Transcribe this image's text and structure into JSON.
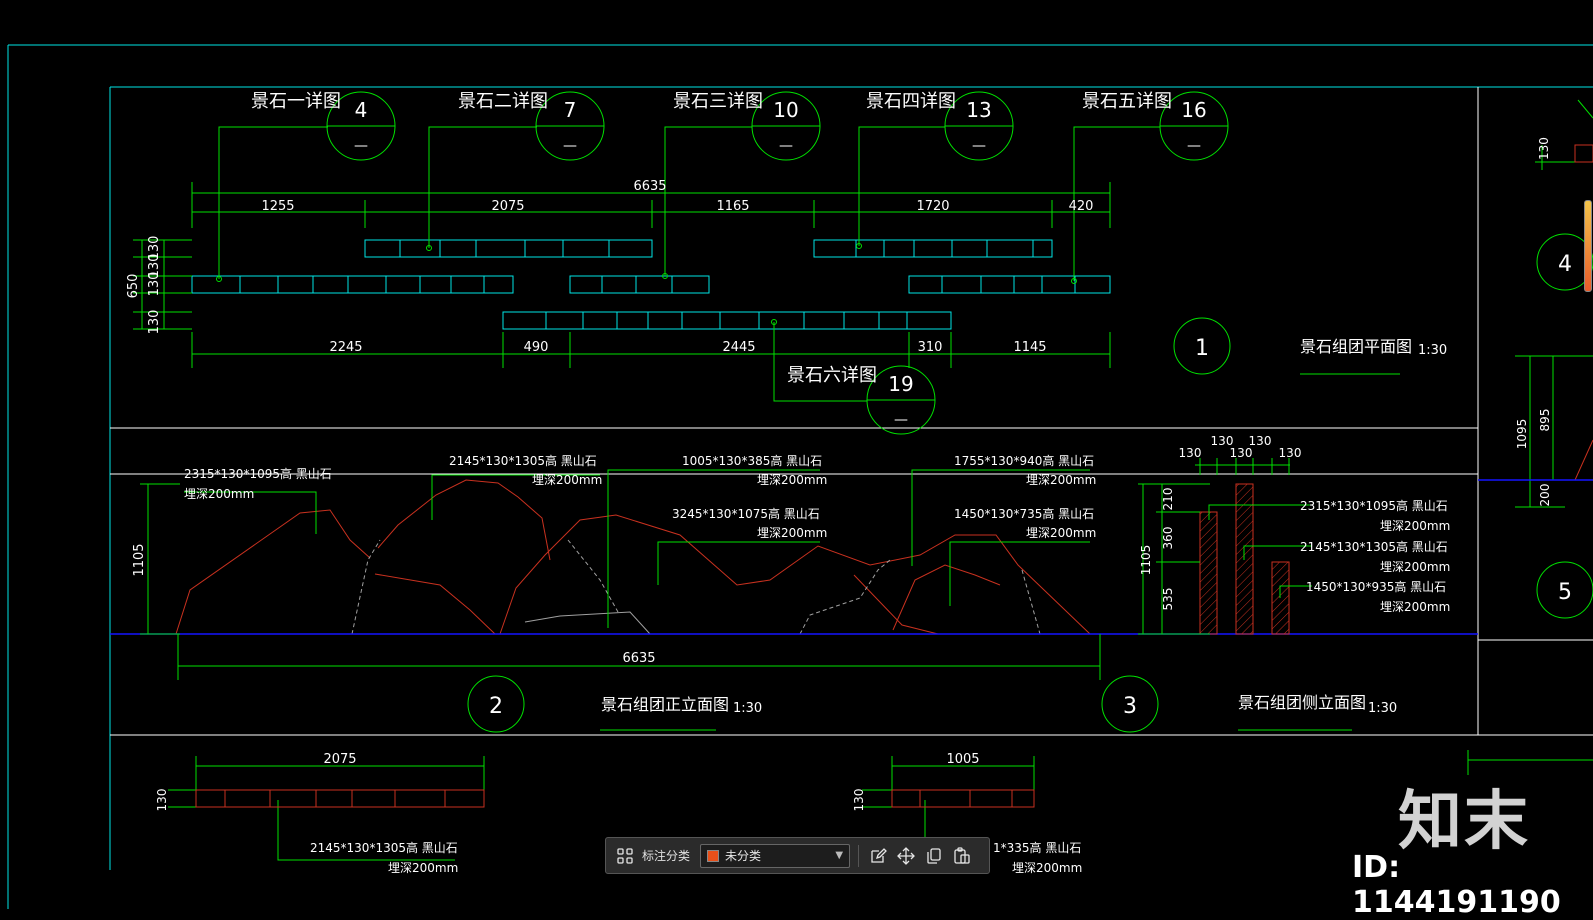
{
  "colors": {
    "frame": "#00e5e5",
    "dim": "#00e000",
    "text": "#ffffff",
    "stone_plan": "#00e5e5",
    "stone_elev": "#c8311f",
    "ground": "#1414ff",
    "grey": "#a0a0a0"
  },
  "plan": {
    "callouts": [
      {
        "label": "景石一详图",
        "num": "4",
        "sub": "—"
      },
      {
        "label": "景石二详图",
        "num": "7",
        "sub": "—"
      },
      {
        "label": "景石三详图",
        "num": "10",
        "sub": "—"
      },
      {
        "label": "景石四详图",
        "num": "13",
        "sub": "—"
      },
      {
        "label": "景石五详图",
        "num": "16",
        "sub": "—"
      },
      {
        "label": "景石六详图",
        "num": "19",
        "sub": "—"
      }
    ],
    "top_total": "6635",
    "top_dims": [
      "1255",
      "2075",
      "1165",
      "1720",
      "420"
    ],
    "bottom_dims": [
      "2245",
      "490",
      "2445",
      "310",
      "1145"
    ],
    "left_dims": [
      "130",
      "130",
      "130",
      "130",
      "650"
    ],
    "view_num": "1",
    "title": "景石组团平面图",
    "scale": "1:30"
  },
  "front": {
    "notes": [
      {
        "size": "2315*130*1095高 黑山石",
        "depth": "埋深200mm"
      },
      {
        "size": "2145*130*1305高 黑山石",
        "depth": "埋深200mm"
      },
      {
        "size": "1005*130*385高 黑山石",
        "depth": "埋深200mm"
      },
      {
        "size": "3245*130*1075高 黑山石",
        "depth": "埋深200mm"
      },
      {
        "size": "1755*130*940高 黑山石",
        "depth": "埋深200mm"
      },
      {
        "size": "1450*130*735高 黑山石",
        "depth": "埋深200mm"
      }
    ],
    "height_dim": "1105",
    "total": "6635",
    "view_num": "2",
    "title": "景石组团正立面图",
    "scale": "1:30"
  },
  "side": {
    "top_dims": [
      "130",
      "130",
      "130",
      "130",
      "130"
    ],
    "left_dims": [
      "210",
      "360",
      "535"
    ],
    "height_dim": "1105",
    "notes": [
      {
        "size": "2315*130*1095高 黑山石",
        "depth": "埋深200mm"
      },
      {
        "size": "2145*130*1305高 黑山石",
        "depth": "埋深200mm"
      },
      {
        "size": "1450*130*935高 黑山石",
        "depth": "埋深200mm"
      }
    ],
    "view_num": "3",
    "title": "景石组团侧立面图",
    "scale": "1:30"
  },
  "right_strip": {
    "dims": [
      "130",
      "1095",
      "895",
      "200"
    ],
    "view_nums": [
      "4",
      "5"
    ]
  },
  "bottom": {
    "dim_a": "2075",
    "dim_b": "1005",
    "side_a": "130",
    "side_b": "130",
    "note_a": {
      "size": "2145*130*1305高 黑山石",
      "depth": "埋深200mm"
    },
    "note_b": {
      "size": "1*335高 黑山石",
      "depth": "埋深200mm"
    }
  },
  "toolbar": {
    "label": "标注分类",
    "selected": "未分类",
    "swatch_color": "#e8501a"
  },
  "watermark": {
    "logo": "知末",
    "id": "ID: 1144191190"
  }
}
